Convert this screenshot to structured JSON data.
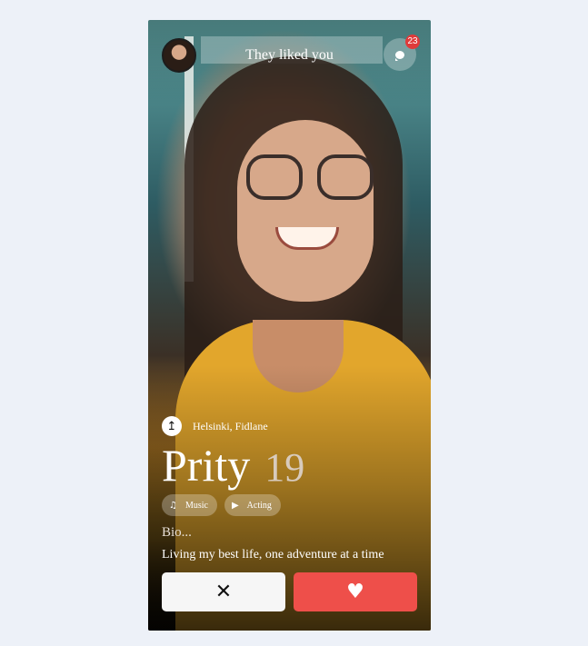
{
  "header": {
    "title": "They liked you",
    "avatar_icon": "user-avatar",
    "chat_icon": "chat-bubble-icon",
    "notification_count": "23"
  },
  "profile": {
    "location_icon": "navigation-arrow-icon",
    "location": "Helsinki, Fidlane",
    "name": "Prity",
    "age": "19",
    "interests": [
      {
        "icon": "music-note-icon",
        "label": "Music"
      },
      {
        "icon": "play-icon",
        "label": "Acting"
      }
    ],
    "bio_label": "Bio...",
    "bio_text": "Living my best life, one adventure at a time"
  },
  "actions": {
    "pass_icon": "close-icon",
    "like_icon": "heart-icon"
  },
  "colors": {
    "background": "#edf1f8",
    "like_button": "#ee4f4a",
    "pass_button": "#f6f6f6",
    "badge": "#e03a3a"
  }
}
